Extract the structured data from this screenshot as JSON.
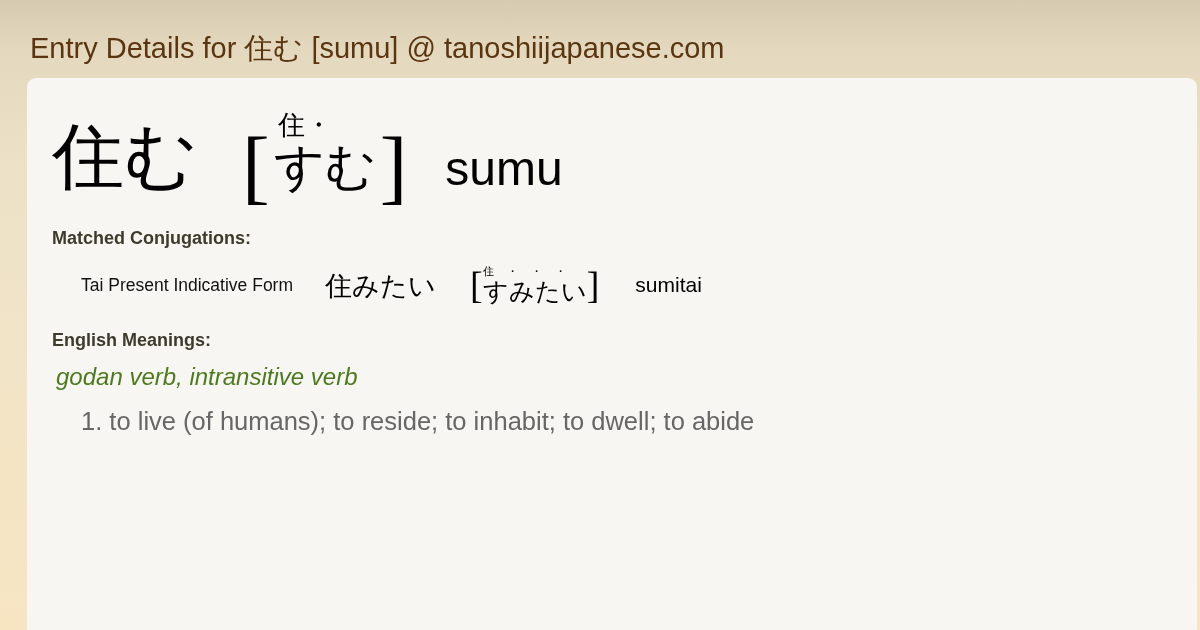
{
  "page_title": "Entry Details for 住む [sumu] @ tanoshiijapanese.com",
  "entry": {
    "word": "住む",
    "reading": {
      "open": "[",
      "furigana": "住・",
      "kana": "すむ",
      "close": "]"
    },
    "romaji": "sumu"
  },
  "conjugations": {
    "heading": "Matched Conjugations:",
    "items": [
      {
        "form": "Tai Present Indicative Form",
        "word": "住みたい",
        "reading": {
          "open": "[",
          "furigana": "住・・・",
          "kana": "すみたい",
          "close": "]"
        },
        "romaji": "sumitai"
      }
    ]
  },
  "meanings": {
    "heading": "English Meanings:",
    "groups": [
      {
        "part_of_speech": "godan verb, intransitive verb",
        "senses": [
          {
            "number": "1.",
            "text": "to live (of humans); to reside; to inhabit; to dwell; to abide"
          }
        ]
      }
    ]
  }
}
